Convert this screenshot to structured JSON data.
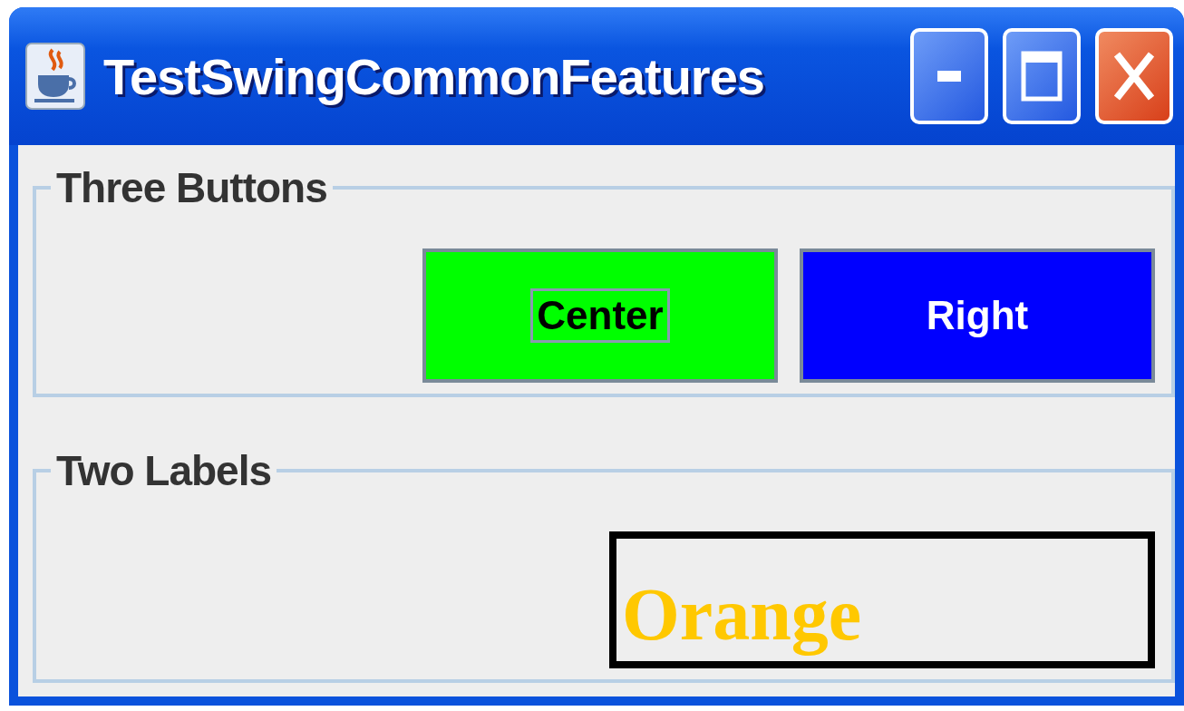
{
  "window": {
    "title": "TestSwingCommonFeatures"
  },
  "groups": [
    {
      "title": "Three Buttons",
      "items": [
        {
          "kind": "button",
          "text": "Center",
          "color": "#00ff00",
          "focused": true
        },
        {
          "kind": "button",
          "text": "Right",
          "color": "#0000ff",
          "focused": false
        }
      ]
    },
    {
      "title": "Two Labels",
      "items": [
        {
          "kind": "label",
          "text": "Orange",
          "color": "#ffc800"
        }
      ]
    }
  ]
}
